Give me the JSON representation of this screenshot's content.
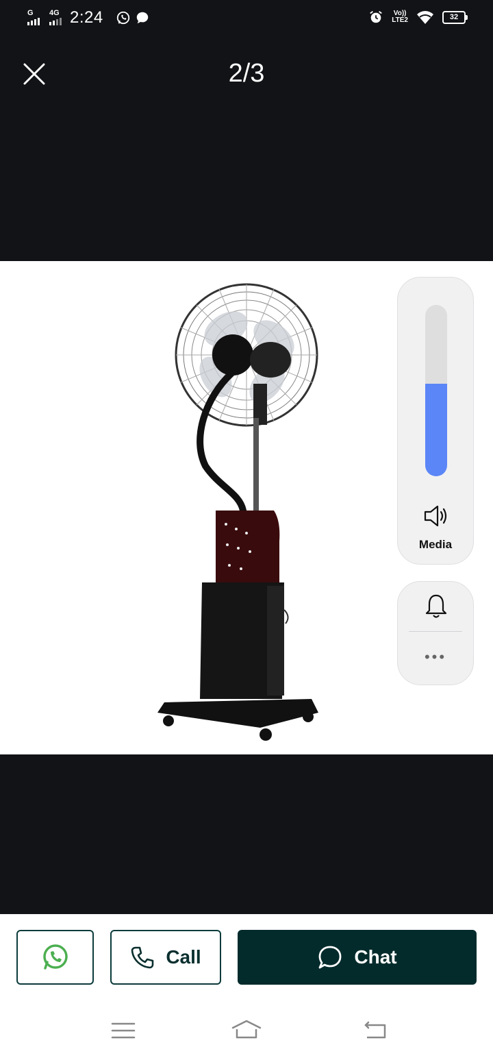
{
  "status_bar": {
    "network_1": "G",
    "network_2": "4G",
    "time": "2:24",
    "volte": "Vo))",
    "lte": "LTE2",
    "battery": "32",
    "icons": [
      "whatsapp-notification-icon",
      "message-notification-icon",
      "alarm-icon",
      "wifi-icon",
      "battery-icon"
    ]
  },
  "viewer": {
    "counter": "2/3",
    "close_icon": "close-icon",
    "image_alt": "Standing mist fan with black base and dark red control panel"
  },
  "volume_panel": {
    "label": "Media",
    "level": 0.54,
    "fill_color": "#5b86f7",
    "icons": [
      "speaker-icon",
      "bell-icon",
      "more-icon"
    ]
  },
  "actions": {
    "whatsapp_icon": "whatsapp-icon",
    "call_label": "Call",
    "chat_label": "Chat",
    "brand_color": "#042b2c",
    "whatsapp_color": "#4caf50"
  },
  "nav": {
    "items": [
      "menu-icon",
      "home-icon",
      "back-icon"
    ]
  }
}
